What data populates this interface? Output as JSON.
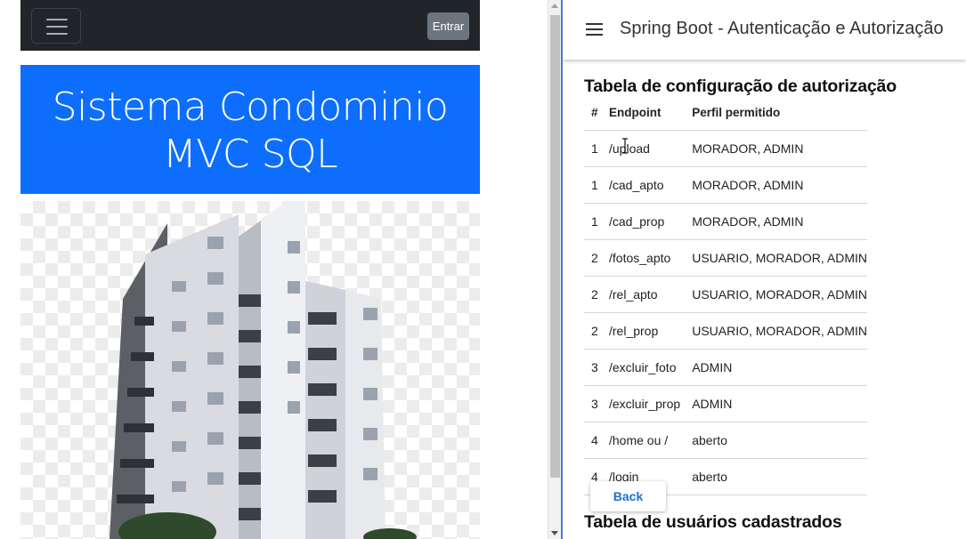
{
  "left": {
    "navbar": {
      "login_label": "Entrar"
    },
    "hero": {
      "line1": "Sistema Condominio",
      "line2": "MVC SQL"
    }
  },
  "right": {
    "app_title": "Spring Boot - Autenticação e Autorização",
    "auth_table": {
      "title": "Tabela de configuração de autorização",
      "headers": [
        "#",
        "Endpoint",
        "Perfil permitido"
      ],
      "rows": [
        [
          "1",
          "/upload",
          "MORADOR, ADMIN"
        ],
        [
          "1",
          "/cad_apto",
          "MORADOR, ADMIN"
        ],
        [
          "1",
          "/cad_prop",
          "MORADOR, ADMIN"
        ],
        [
          "2",
          "/fotos_apto",
          "USUARIO, MORADOR, ADMIN"
        ],
        [
          "2",
          "/rel_apto",
          "USUARIO, MORADOR, ADMIN"
        ],
        [
          "2",
          "/rel_prop",
          "USUARIO, MORADOR, ADMIN"
        ],
        [
          "3",
          "/excluir_foto",
          "ADMIN"
        ],
        [
          "3",
          "/excluir_prop",
          "ADMIN"
        ],
        [
          "4",
          "/home ou /",
          "aberto"
        ],
        [
          "4",
          "/login",
          "aberto"
        ]
      ]
    },
    "back_label": "Back",
    "users_title": "Tabela de usuários cadastrados"
  }
}
